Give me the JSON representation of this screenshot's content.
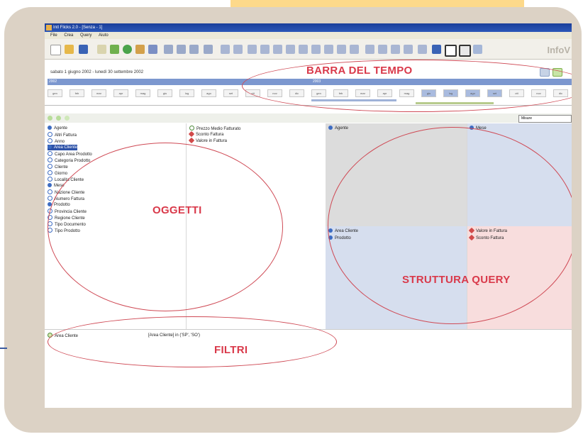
{
  "window": {
    "title": "Intl Flicks 2.0 - [Senza - 1]",
    "menu": [
      "File",
      "Crea",
      "Query",
      "Aiuto"
    ],
    "brand": "InfoV"
  },
  "timebar": {
    "period_text": "sabato 1 giugno 2002 - lunedì 30 settembre 2002",
    "years": [
      "2002",
      "2003"
    ],
    "months": [
      "gen",
      "feb",
      "mar",
      "apr",
      "mag",
      "giu",
      "lug",
      "ago",
      "set",
      "ott",
      "nov",
      "dic"
    ],
    "selected_months": [
      "giu",
      "lug",
      "ago",
      "set"
    ]
  },
  "objects_toolbar": {
    "dropdown_value": "Misure"
  },
  "objects": {
    "column1": [
      {
        "label": "Agente",
        "icon": "dimension-filled-icon"
      },
      {
        "label": "Altri Fattura",
        "icon": "dimension-outline-icon"
      },
      {
        "label": "Anno",
        "icon": "dimension-outline-icon"
      },
      {
        "label": "Area Cliente",
        "icon": "dimension-filled-icon",
        "selected": true
      },
      {
        "label": "Capo Area Prodotto",
        "icon": "dimension-outline-icon"
      },
      {
        "label": "Categoria Prodotto",
        "icon": "dimension-outline-icon"
      },
      {
        "label": "Cliente",
        "icon": "dimension-outline-icon"
      },
      {
        "label": "Giorno",
        "icon": "dimension-outline-icon"
      },
      {
        "label": "Localita Cliente",
        "icon": "dimension-outline-icon"
      },
      {
        "label": "Mese",
        "icon": "dimension-filled-icon"
      },
      {
        "label": "Nazione Cliente",
        "icon": "dimension-outline-icon"
      },
      {
        "label": "Numero Fattura",
        "icon": "dimension-outline-icon"
      },
      {
        "label": "Prodotto",
        "icon": "dimension-filled-icon"
      },
      {
        "label": "Provincia Cliente",
        "icon": "dimension-outline-icon"
      },
      {
        "label": "Regione Cliente",
        "icon": "dimension-outline-icon"
      },
      {
        "label": "Tipo Documento",
        "icon": "dimension-outline-icon"
      },
      {
        "label": "Tipo Prodotto",
        "icon": "dimension-outline-icon"
      }
    ],
    "column2": [
      {
        "label": "Prezzo Medio Fatturato",
        "icon": "measure-outline-icon"
      },
      {
        "label": "Sconto Fattura",
        "icon": "measure-filled-icon"
      },
      {
        "label": "Valore in Fattura",
        "icon": "measure-filled-icon"
      }
    ]
  },
  "query_structure": {
    "rows": [
      "Agente"
    ],
    "columns": [
      "Mese"
    ],
    "row_dims": [
      "Area Cliente",
      "Prodotto"
    ],
    "measures": [
      "Valore in Fattura",
      "Sconto Fattura"
    ]
  },
  "filters": {
    "items": [
      {
        "name": "Area Cliente",
        "expression": "[Area Cliente] in ('SP', 'SO')"
      }
    ]
  },
  "annotations": {
    "barra_del_tempo": "BARRA DEL TEMPO",
    "oggetti": "OGGETTI",
    "struttura_query": "STRUTTURA QUERY",
    "filtri": "FILTRI"
  },
  "colors": {
    "frame": "#dcd2c5",
    "annotation": "#d9394a",
    "titlebar": "#1a3e9a",
    "rows_area": "#dcdcdc",
    "columns_area": "#d6deee",
    "measures_area": "#f8dddd"
  }
}
